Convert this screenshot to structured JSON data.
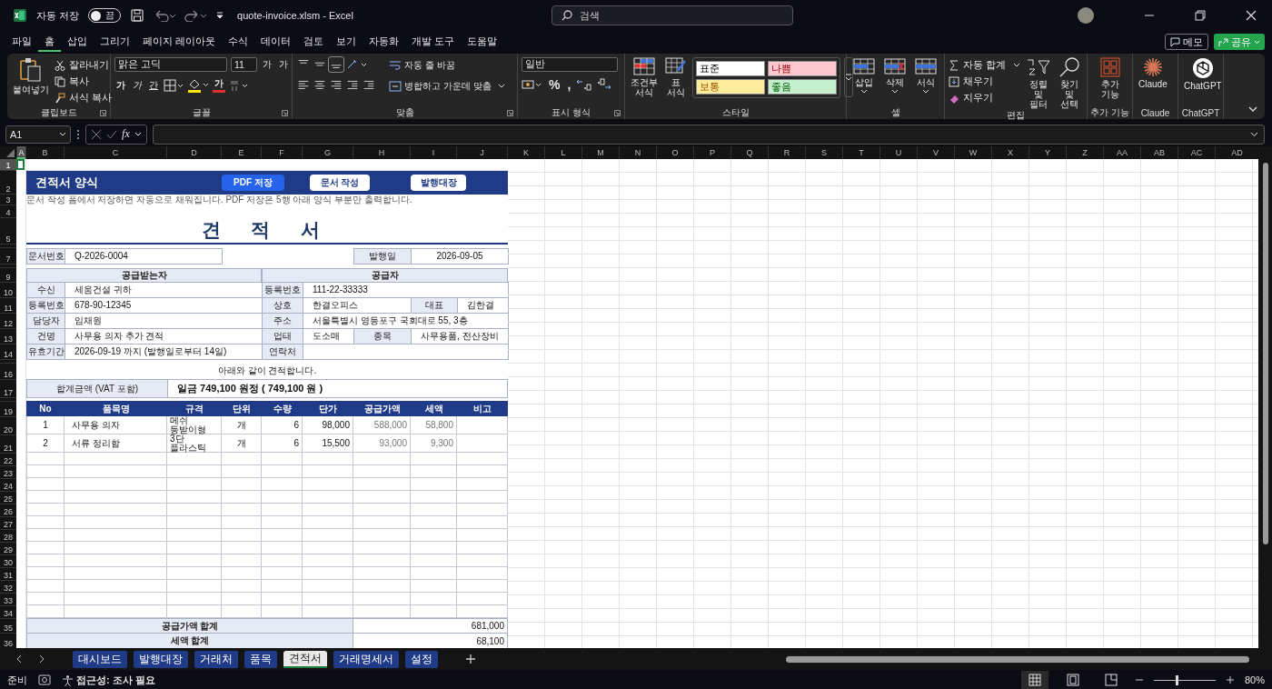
{
  "title_bar": {
    "autosave_label": "자동 저장",
    "autosave": {
      "label": "끔",
      "on": false
    },
    "file_title": "quote-invoice.xlsm  -  Excel",
    "search": {
      "placeholder": "검색"
    }
  },
  "menu_tabs": [
    {
      "label": "파일",
      "selected": false
    },
    {
      "label": "홈",
      "selected": true
    },
    {
      "label": "삽입",
      "selected": false
    },
    {
      "label": "그리기",
      "selected": false
    },
    {
      "label": "페이지 레이아웃",
      "selected": false
    },
    {
      "label": "수식",
      "selected": false
    },
    {
      "label": "데이터",
      "selected": false
    },
    {
      "label": "검토",
      "selected": false
    },
    {
      "label": "보기",
      "selected": false
    },
    {
      "label": "자동화",
      "selected": false
    },
    {
      "label": "개발 도구",
      "selected": false
    },
    {
      "label": "도움말",
      "selected": false
    }
  ],
  "header_actions": {
    "memo": "메모",
    "share": "공유"
  },
  "ribbon": {
    "clipboard": {
      "paste": "붙여넣기",
      "cut": "잘라내기",
      "copy": "복사",
      "format_painter": "서식 복사",
      "label": "클립보드"
    },
    "font": {
      "name": "맑은 고딕",
      "size": "11",
      "grow": "가",
      "shrink": "가",
      "styles": [
        "가",
        "가",
        "간"
      ],
      "font_color": "가",
      "label": "글꼴"
    },
    "alignment": {
      "wrap": "자동 줄 바꿈",
      "merge": "병합하고 가운데 맞춤",
      "label": "맞춤"
    },
    "number": {
      "format": "일반",
      "percent": "%",
      "comma": ",",
      "label": "표시 형식"
    },
    "styles": {
      "conditional": "조건부 서식",
      "table": "표 서식",
      "cell_styles": [
        {
          "label": "표준",
          "kind": "normal",
          "color": "#ffffff"
        },
        {
          "label": "나쁨",
          "kind": "bad",
          "color": "#ffc7ce"
        },
        {
          "label": "보통",
          "kind": "neutral",
          "color": "#ffeb9c"
        },
        {
          "label": "좋음",
          "kind": "good",
          "color": "#c6efce"
        }
      ],
      "label": "스타일"
    },
    "cells": {
      "buttons": [
        "삽입",
        "삭제",
        "서식"
      ],
      "label": "셀"
    },
    "editing": {
      "autosum": "자동 합계",
      "fill": "채우기",
      "clear": "지우기",
      "sort_filter": "정렬 및 필터",
      "find_select": "찾기 및 선택",
      "label": "편집"
    },
    "addins": {
      "button": "추가 기능",
      "label": "추가 기능"
    },
    "claude": {
      "button": "Claude",
      "label": "Claude"
    },
    "chatgpt": {
      "button": "ChatGPT",
      "label": "ChatGPT"
    }
  },
  "formula_bar": {
    "name_box": "A1",
    "fx": "fx"
  },
  "column_headers": [
    "A",
    "B",
    "C",
    "D",
    "E",
    "F",
    "G",
    "H",
    "I",
    "J",
    "K",
    "L",
    "M",
    "N",
    "O",
    "P",
    "Q",
    "R",
    "S",
    "T",
    "U",
    "V",
    "W",
    "X",
    "Y",
    "Z",
    "AA",
    "AB",
    "AC",
    "AD"
  ],
  "row_numbers": [
    "1",
    "2",
    "3",
    "4",
    "5",
    "7",
    "9",
    "10",
    "11",
    "12",
    "13",
    "14",
    "16",
    "17",
    "19",
    "20",
    "21",
    "22",
    "23",
    "24",
    "25",
    "26",
    "27",
    "28",
    "29",
    "30",
    "31",
    "32",
    "33",
    "34",
    "35",
    "36"
  ],
  "sheet": {
    "band": {
      "title": "견적서 양식",
      "buttons": [
        {
          "label": "PDF 저장",
          "kind": "primary"
        },
        {
          "label": "문서 작성",
          "kind": "secondary"
        },
        {
          "label": "발행대장",
          "kind": "secondary"
        }
      ]
    },
    "note": "문서 작성 폼에서 저장하면 자동으로 채워집니다. PDF 저장은 5행 아래 양식 부분만 출력합니다.",
    "doc_title": "견 적 서",
    "doc_no": {
      "label": "문서번호",
      "value": "Q-2026-0004"
    },
    "issue_date": {
      "label": "발행일",
      "value": "2026-09-05"
    },
    "recipient": {
      "heading": "공급받는자",
      "fields": [
        {
          "label": "수신",
          "value": "세움건설 귀하"
        },
        {
          "label": "등록번호",
          "value": "678-90-12345"
        },
        {
          "label": "담당자",
          "value": "임채원"
        },
        {
          "label": "건명",
          "value": "사무용 의자 추가 견적"
        },
        {
          "label": "유효기간",
          "value": "2026-09-19 까지 (발행일로부터 14일)"
        }
      ]
    },
    "supplier": {
      "heading": "공급자",
      "fields": [
        {
          "kind": "single",
          "label": "등록번호",
          "value": "111-22-33333"
        },
        {
          "kind": "pair_a",
          "label": "상호",
          "value": "한결오피스",
          "label2": "대표",
          "value2": "김한결"
        },
        {
          "kind": "single",
          "label": "주소",
          "value": "서울특별시 영등포구 국회대로 55, 3층"
        },
        {
          "kind": "pair_b",
          "label": "업태",
          "value": "도소매",
          "label2": "종목",
          "value2": "사무용품, 전산장비"
        },
        {
          "kind": "single",
          "label": "연락처"
        }
      ]
    },
    "intro": "아래와 같이 견적합니다.",
    "total": {
      "label": "합계금액 (VAT 포함)",
      "value": "일금 749,100 원정  ( 749,100 원 )"
    },
    "items": {
      "columns": [
        "No",
        "품목명",
        "규격",
        "단위",
        "수량",
        "단가",
        "공급가액",
        "세액",
        "비고"
      ],
      "rows": [
        [
          "1",
          "사무용 의자",
          "메쉬 등받이형",
          "개",
          "6",
          "98,000",
          "588,000",
          "58,800",
          ""
        ],
        [
          "2",
          "서류 정리함",
          "3단 플라스틱",
          "개",
          "6",
          "15,500",
          "93,000",
          "9,300",
          ""
        ]
      ]
    },
    "summary": [
      {
        "label": "공급가액 합계",
        "value": "681,000"
      },
      {
        "label": "세액 합계",
        "value": "68,100"
      }
    ]
  },
  "sheet_tabs": [
    {
      "label": "대시보드",
      "selected": false
    },
    {
      "label": "발행대장",
      "selected": false
    },
    {
      "label": "거래처",
      "selected": false
    },
    {
      "label": "품목",
      "selected": false
    },
    {
      "label": "견적서",
      "selected": true
    },
    {
      "label": "거래명세서",
      "selected": false
    },
    {
      "label": "설정",
      "selected": false
    }
  ],
  "status_bar": {
    "ready": "준비",
    "accessibility": "접근성: 조사 필요",
    "zoom": {
      "level": 0.35
    },
    "zoom_text": "80%"
  }
}
